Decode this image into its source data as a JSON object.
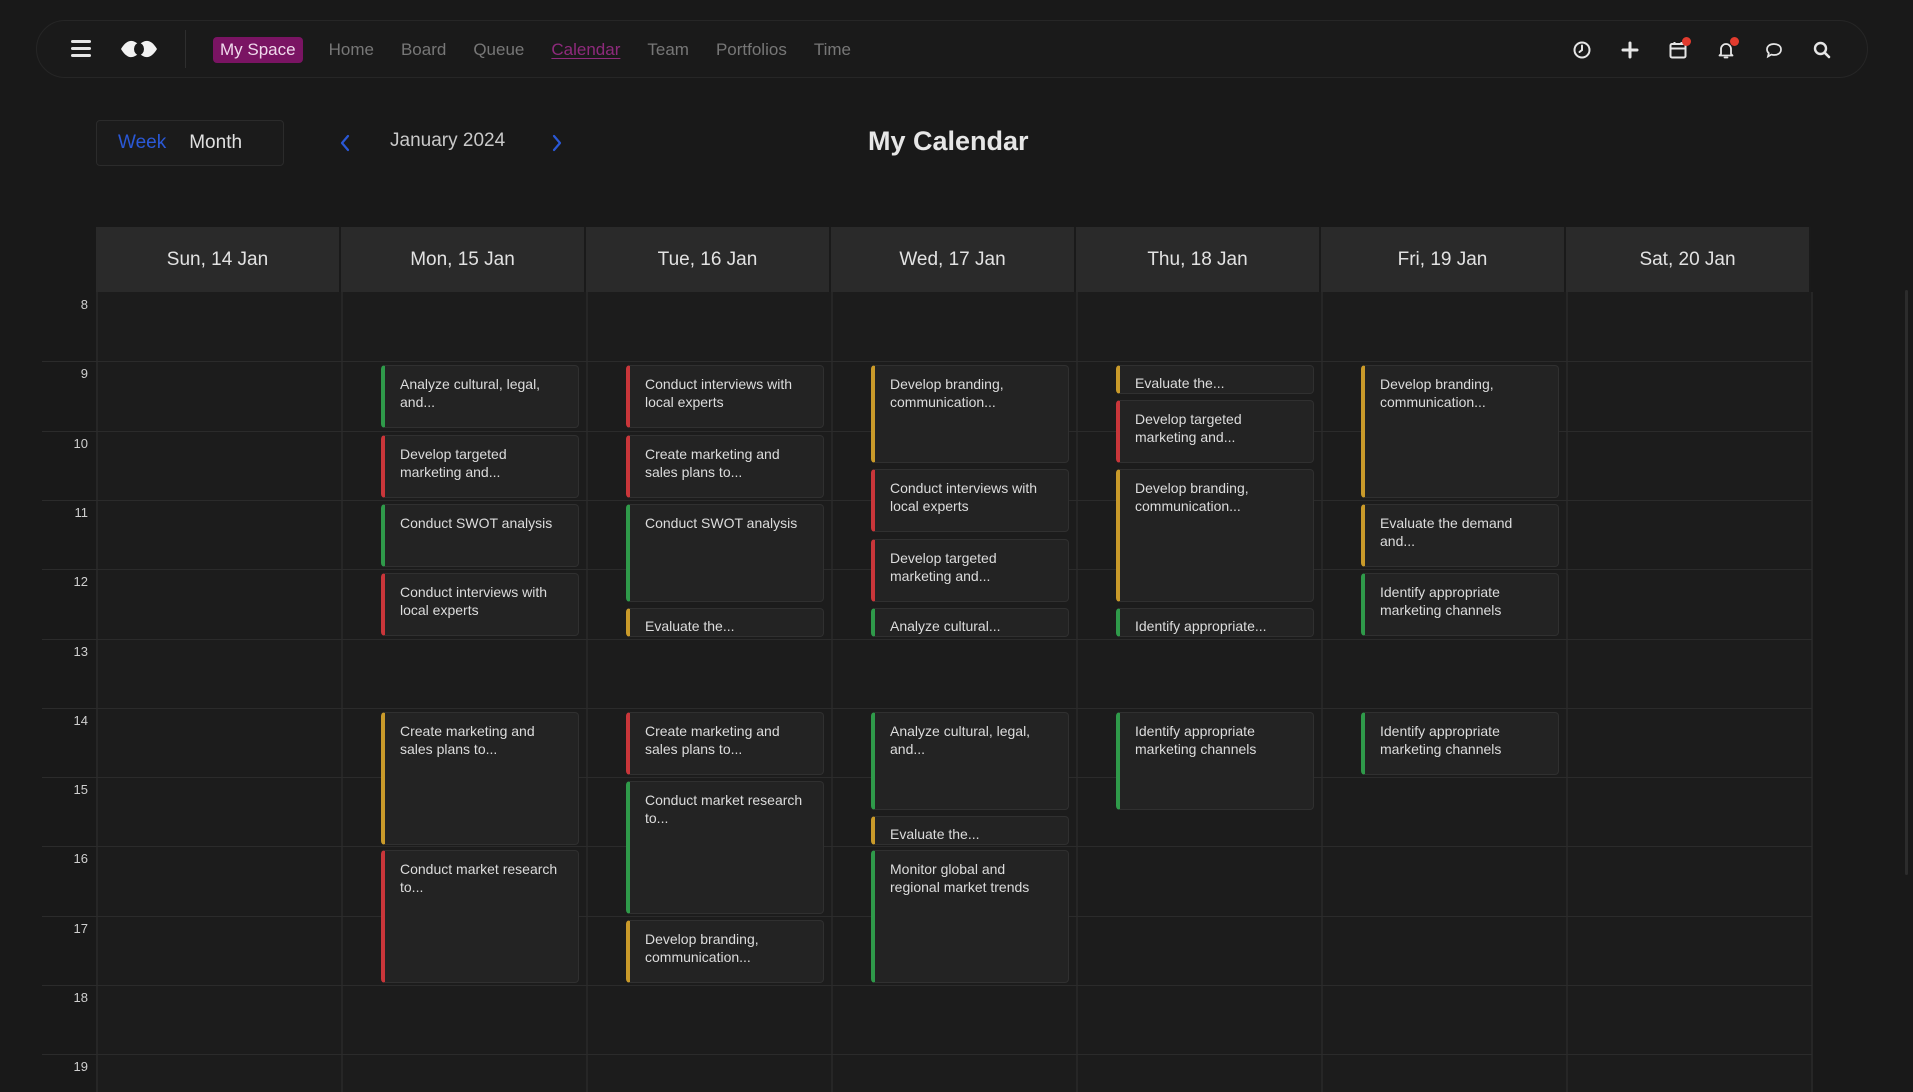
{
  "nav": {
    "my_space": "My Space",
    "items": [
      "Home",
      "Board",
      "Queue",
      "Calendar",
      "Team",
      "Portfolios",
      "Time"
    ],
    "active": "Calendar"
  },
  "top_icons": [
    "clock-icon",
    "plus-icon",
    "calendar-icon",
    "bell-icon",
    "chat-icon",
    "search-icon"
  ],
  "toolbar": {
    "week_label": "Week",
    "month_label": "Month",
    "current_period": "January 2024",
    "title": "My Calendar"
  },
  "days": [
    "Sun, 14 Jan",
    "Mon, 15 Jan",
    "Tue, 16 Jan",
    "Wed, 17 Jan",
    "Thu, 18 Jan",
    "Fri, 19 Jan",
    "Sat, 20 Jan"
  ],
  "hours": [
    "8",
    "9",
    "10",
    "11",
    "12",
    "13",
    "14",
    "15",
    "16",
    "17",
    "18",
    "19"
  ],
  "colors": {
    "red": "#c9363a",
    "green": "#2f9a4a",
    "amber": "#c99a2a",
    "accent": "#7a1463",
    "week_active": "#2a58d6"
  },
  "events": [
    {
      "day": 1,
      "start": 9,
      "end": 10,
      "color": "green",
      "label": "Analyze cultural, legal, and..."
    },
    {
      "day": 1,
      "start": 10,
      "end": 11,
      "color": "red",
      "label": "Develop targeted marketing and..."
    },
    {
      "day": 1,
      "start": 11,
      "end": 12,
      "color": "green",
      "label": "Conduct SWOT analysis"
    },
    {
      "day": 1,
      "start": 12,
      "end": 13,
      "color": "red",
      "label": "Conduct interviews with local experts"
    },
    {
      "day": 1,
      "start": 14,
      "end": 16,
      "color": "amber",
      "label": "Create marketing and sales plans to..."
    },
    {
      "day": 1,
      "start": 16,
      "end": 18,
      "color": "red",
      "label": "Conduct market research to..."
    },
    {
      "day": 2,
      "start": 9,
      "end": 10,
      "color": "red",
      "label": "Conduct interviews with local experts"
    },
    {
      "day": 2,
      "start": 10,
      "end": 11,
      "color": "red",
      "label": "Create marketing and sales plans to..."
    },
    {
      "day": 2,
      "start": 11,
      "end": 12.5,
      "color": "green",
      "label": "Conduct SWOT analysis"
    },
    {
      "day": 2,
      "start": 12.5,
      "end": 13,
      "color": "amber",
      "label": "Evaluate the..."
    },
    {
      "day": 2,
      "start": 14,
      "end": 15,
      "color": "red",
      "label": "Create marketing and sales plans to..."
    },
    {
      "day": 2,
      "start": 15,
      "end": 17,
      "color": "green",
      "label": "Conduct market research to..."
    },
    {
      "day": 2,
      "start": 17,
      "end": 18,
      "color": "amber",
      "label": "Develop branding, communication..."
    },
    {
      "day": 3,
      "start": 9,
      "end": 10.5,
      "color": "amber",
      "label": "Develop branding, communication..."
    },
    {
      "day": 3,
      "start": 10.5,
      "end": 11.5,
      "color": "red",
      "label": "Conduct interviews with local experts"
    },
    {
      "day": 3,
      "start": 11.5,
      "end": 12.5,
      "color": "red",
      "label": "Develop targeted marketing and..."
    },
    {
      "day": 3,
      "start": 12.5,
      "end": 13,
      "color": "green",
      "label": "Analyze cultural..."
    },
    {
      "day": 3,
      "start": 14,
      "end": 15.5,
      "color": "green",
      "label": "Analyze cultural, legal, and..."
    },
    {
      "day": 3,
      "start": 15.5,
      "end": 16,
      "color": "amber",
      "label": "Evaluate the..."
    },
    {
      "day": 3,
      "start": 16,
      "end": 18,
      "color": "green",
      "label": "Monitor global and regional market trends"
    },
    {
      "day": 4,
      "start": 9,
      "end": 9.5,
      "color": "amber",
      "label": "Evaluate the..."
    },
    {
      "day": 4,
      "start": 9.5,
      "end": 10.5,
      "color": "red",
      "label": "Develop targeted marketing and..."
    },
    {
      "day": 4,
      "start": 10.5,
      "end": 12.5,
      "color": "amber",
      "label": "Develop branding, communication..."
    },
    {
      "day": 4,
      "start": 12.5,
      "end": 13,
      "color": "green",
      "label": "Identify appropriate..."
    },
    {
      "day": 4,
      "start": 14,
      "end": 15.5,
      "color": "green",
      "label": "Identify appropriate marketing channels"
    },
    {
      "day": 5,
      "start": 9,
      "end": 11,
      "color": "amber",
      "label": "Develop branding, communication..."
    },
    {
      "day": 5,
      "start": 11,
      "end": 12,
      "color": "amber",
      "label": "Evaluate the demand and..."
    },
    {
      "day": 5,
      "start": 12,
      "end": 13,
      "color": "green",
      "label": "Identify appropriate marketing channels"
    },
    {
      "day": 5,
      "start": 14,
      "end": 15,
      "color": "green",
      "label": "Identify appropriate marketing channels"
    }
  ]
}
